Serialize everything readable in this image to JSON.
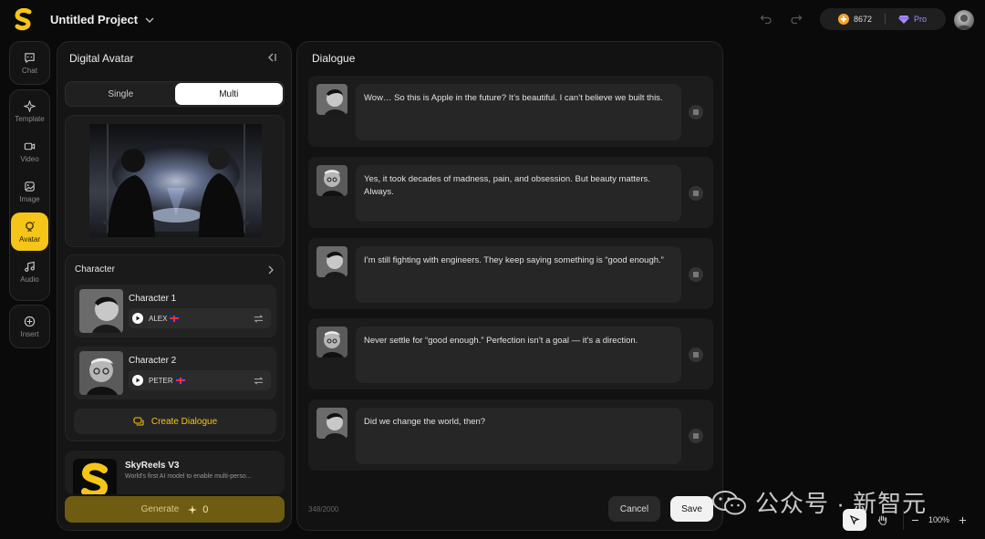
{
  "header": {
    "project_title": "Untitled Project",
    "credits": "8672",
    "plan": "Pro"
  },
  "sidebar": {
    "items": [
      {
        "label": "Chat",
        "icon": "chat-icon"
      },
      {
        "label": "Template",
        "icon": "template-icon"
      },
      {
        "label": "Video",
        "icon": "video-icon"
      },
      {
        "label": "Image",
        "icon": "image-icon"
      },
      {
        "label": "Avatar",
        "icon": "avatar-icon",
        "active": true
      },
      {
        "label": "Audio",
        "icon": "audio-icon"
      },
      {
        "label": "Insert",
        "icon": "plus-circle-icon"
      }
    ]
  },
  "avatar_panel": {
    "title": "Digital Avatar",
    "modes": [
      "Single",
      "Multi"
    ],
    "active_mode": "Multi",
    "character_heading": "Character",
    "characters": [
      {
        "name": "Character 1",
        "voice": "ALEX"
      },
      {
        "name": "Character 2",
        "voice": "PETER"
      }
    ],
    "create_label": "Create Dialogue",
    "model": {
      "name": "SkyReels V3",
      "description": "World's first AI model to enable multi-perso..."
    },
    "generate_label": "Generate",
    "generate_cost": "0"
  },
  "dialogue": {
    "title": "Dialogue",
    "lines": [
      "Wow… So this is Apple in the future? It’s beautiful. I can’t believe we built this.",
      "Yes, it took decades of madness, pain, and obsession. But beauty matters. Always.",
      "I’m still fighting with engineers. They keep saying something is “good enough.”",
      "Never settle for “good enough.” Perfection isn’t a goal — it’s a direction.",
      "Did we change the world, then?"
    ],
    "char_count": "348/2000",
    "cancel_label": "Cancel",
    "save_label": "Save"
  },
  "tools": {
    "zoom": "100%"
  },
  "watermark": "公众号 · 新智元",
  "colors": {
    "accent": "#f5c518",
    "background": "#0a0a0a",
    "panel": "#151515",
    "pro": "#a78bfa"
  }
}
